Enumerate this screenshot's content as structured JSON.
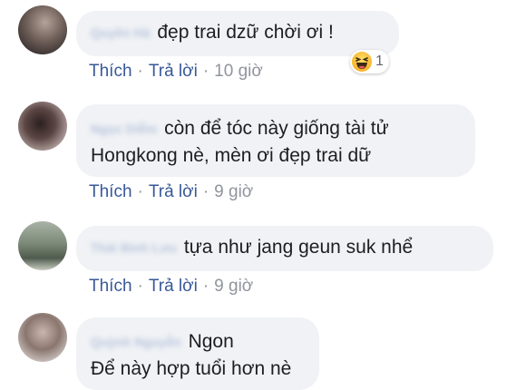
{
  "comments": [
    {
      "author": "Quyên Hà",
      "text_lines": [
        "đẹp trai dzữ chời ơi !"
      ],
      "actions": {
        "like": "Thích",
        "reply": "Trả lời",
        "time": "10 giờ"
      },
      "reaction": {
        "icon": "haha-icon",
        "count": "1"
      }
    },
    {
      "author": "Ngọc Diễm",
      "text_lines": [
        "còn để tóc này giống tài tử",
        "Hongkong nè, mèn ơi đẹp trai dữ"
      ],
      "actions": {
        "like": "Thích",
        "reply": "Trả lời",
        "time": "9 giờ"
      }
    },
    {
      "author": "Thái Bình Lưu",
      "text_lines": [
        "tựa như jang geun suk nhể"
      ],
      "actions": {
        "like": "Thích",
        "reply": "Trả lời",
        "time": "9 giờ"
      }
    },
    {
      "author": "Quỳnh Nguyễn",
      "text_lines": [
        "Ngon",
        "Để này hợp tuổi hơn nè"
      ]
    }
  ],
  "separator": "·",
  "colors": {
    "bubble": "#f0f2f5",
    "link": "#385898",
    "muted": "#90949c",
    "text": "#1c1e21"
  }
}
